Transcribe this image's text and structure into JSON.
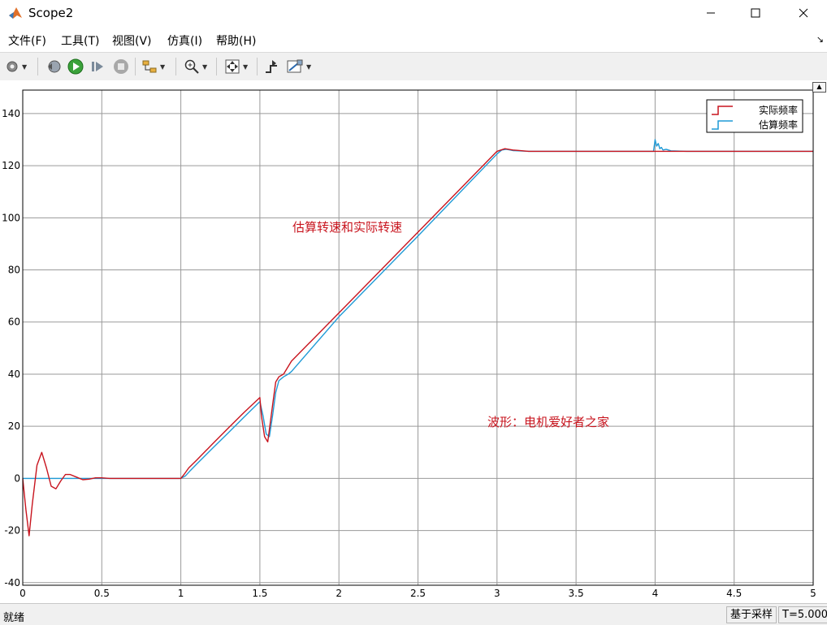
{
  "window": {
    "title": "Scope2",
    "icon": "matlab-icon",
    "controls": [
      "minimize-icon",
      "maximize-icon",
      "close-icon"
    ]
  },
  "menu": {
    "items": [
      "文件(F)",
      "工具(T)",
      "视图(V)",
      "仿真(I)",
      "帮助(H)"
    ],
    "corner_glyph": "↘"
  },
  "toolbar": {
    "buttons": [
      "settings-icon",
      "step-back-icon",
      "run-icon",
      "step-forward-icon",
      "stop-icon",
      "signal-select-icon",
      "zoom-icon",
      "autoscale-icon",
      "cursor-icon",
      "measure-icon"
    ]
  },
  "plot": {
    "annotation_1": "估算转速和实际转速",
    "annotation_2": "波形：电机爱好者之家",
    "legend_position": "top-right",
    "grid": true,
    "colors": {
      "actual": "#c8141e",
      "estimated": "#1f9ad6",
      "annotation": "#c8141e"
    }
  },
  "chart_data": {
    "type": "line",
    "xlim": [
      0,
      5
    ],
    "ylim": [
      -41,
      149
    ],
    "xticks": [
      "0",
      "0.5",
      "1",
      "1.5",
      "2",
      "2.5",
      "3",
      "3.5",
      "4",
      "4.5",
      "5"
    ],
    "yticks": [
      "-40",
      "-20",
      "0",
      "20",
      "40",
      "60",
      "80",
      "100",
      "120",
      "140"
    ],
    "series": [
      {
        "name": "实际频率",
        "color": "#c8141e",
        "x": [
          0,
          0.02,
          0.04,
          0.06,
          0.09,
          0.12,
          0.15,
          0.18,
          0.21,
          0.24,
          0.27,
          0.3,
          0.34,
          0.38,
          0.42,
          0.46,
          0.5,
          0.55,
          0.6,
          1.0,
          1.02,
          1.05,
          1.1,
          1.2,
          1.3,
          1.4,
          1.5,
          1.51,
          1.53,
          1.55,
          1.58,
          1.6,
          1.62,
          1.65,
          1.7,
          2.0,
          2.5,
          3.0,
          3.05,
          3.1,
          3.2,
          3.5,
          4.0,
          4.5,
          5.0
        ],
        "y": [
          0,
          -12,
          -22,
          -10,
          5,
          10,
          4,
          -3,
          -4,
          -1,
          1.5,
          1.5,
          0.5,
          -0.5,
          -0.3,
          0.2,
          0.2,
          0,
          0,
          0,
          1.5,
          4,
          7,
          13.2,
          19.3,
          25.3,
          31,
          24,
          16,
          14,
          28,
          37,
          39,
          40,
          45,
          63.5,
          94.5,
          125.5,
          126.5,
          126,
          125.5,
          125.5,
          125.5,
          125.5,
          125.5
        ]
      },
      {
        "name": "估算频率",
        "color": "#1f9ad6",
        "x": [
          0,
          1.0,
          1.03,
          1.06,
          1.1,
          1.2,
          1.3,
          1.4,
          1.5,
          1.52,
          1.54,
          1.56,
          1.58,
          1.6,
          1.62,
          1.65,
          1.68,
          1.7,
          2.0,
          2.5,
          3.0,
          3.03,
          3.06,
          3.1,
          3.2,
          3.5,
          3.99,
          4.0,
          4.01,
          4.02,
          4.03,
          4.04,
          4.05,
          4.07,
          4.1,
          4.2,
          4.5,
          5.0
        ],
        "y": [
          0,
          0,
          1,
          3,
          5.5,
          11.5,
          17.5,
          23.5,
          29.5,
          24,
          17,
          16,
          24,
          33,
          37.5,
          39,
          40,
          41,
          62,
          93,
          124.5,
          126,
          126.3,
          125.8,
          125.5,
          125.5,
          125.5,
          130,
          127.5,
          128.5,
          126.5,
          127,
          126,
          126.3,
          125.7,
          125.5,
          125.5,
          125.5
        ]
      }
    ]
  },
  "status": {
    "left": "就绪",
    "mode": "基于采样",
    "time": "T=5.000"
  }
}
